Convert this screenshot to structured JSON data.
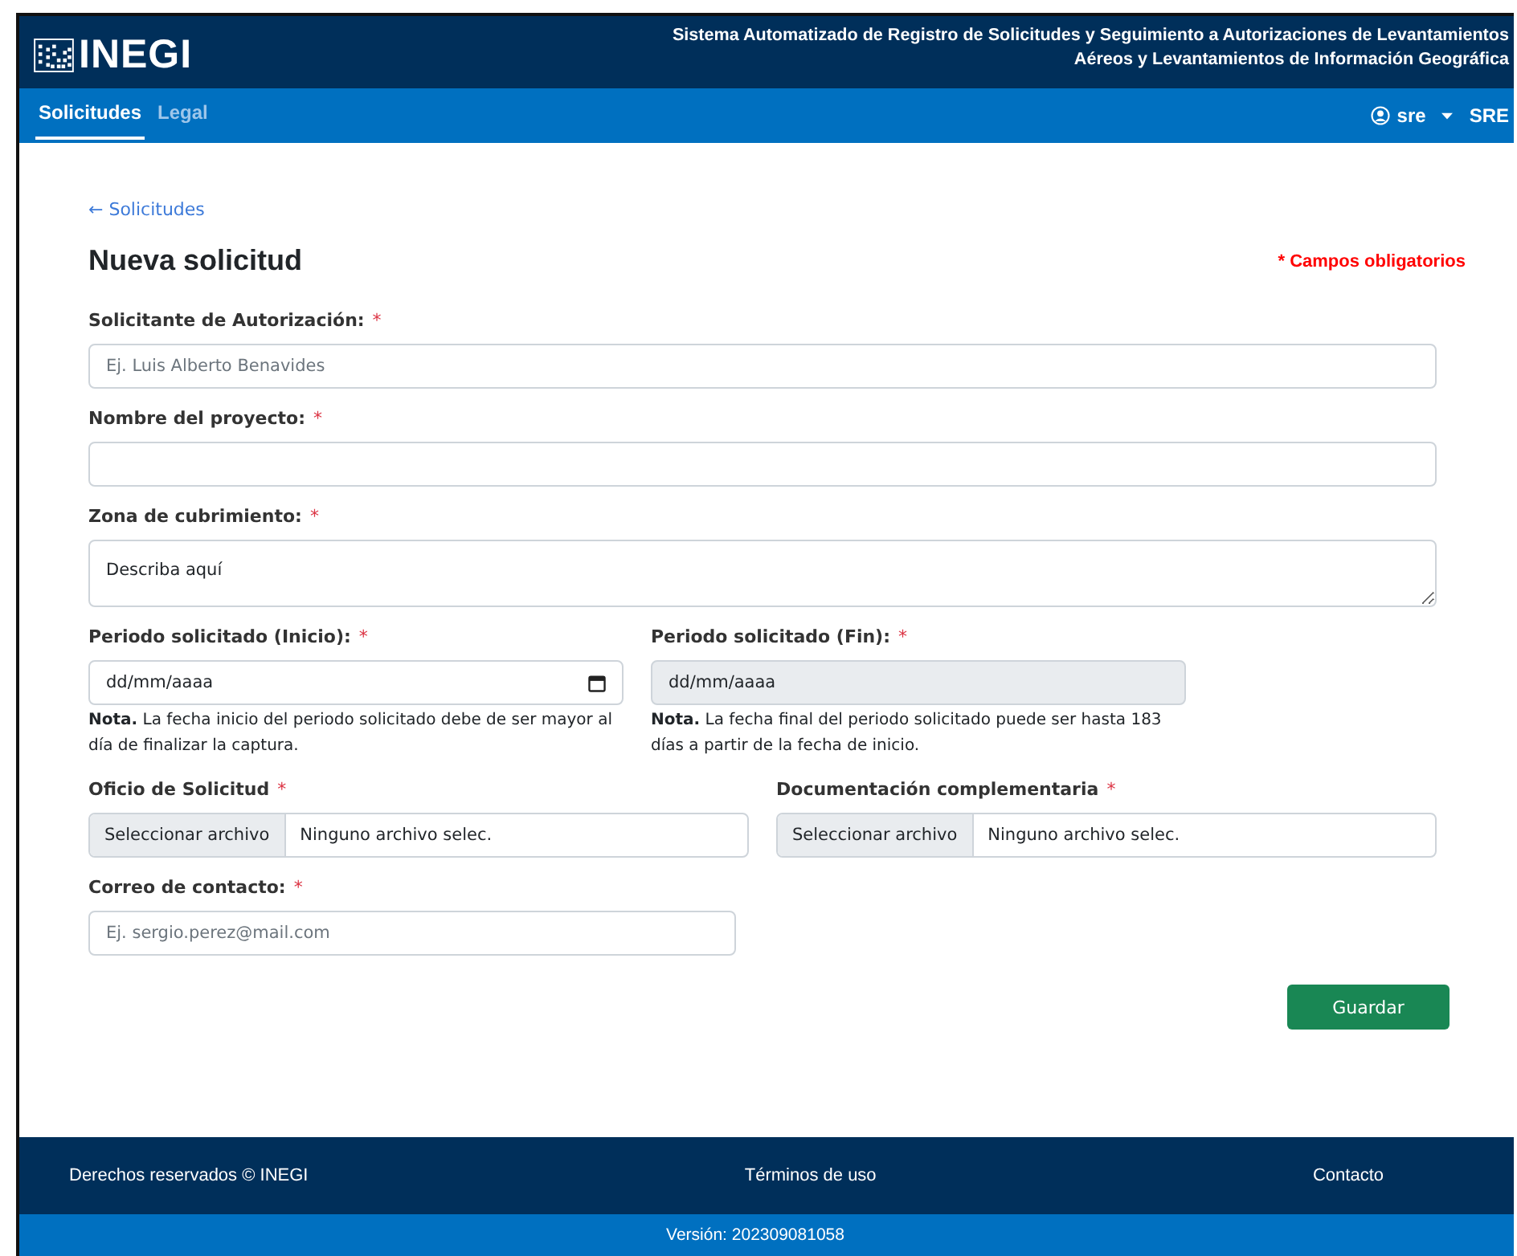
{
  "header": {
    "logo_text": "INEGI",
    "title_lines": [
      "Sistema Automatizado de Registro de Solicitudes y Seguimiento a Autorizaciones de Levantamientos",
      "Aéreos y Levantamientos de Información Geográfica"
    ]
  },
  "nav": {
    "tabs": [
      {
        "label": "Solicitudes",
        "selected": true
      },
      {
        "label": "Legal",
        "selected": false
      }
    ],
    "user": "sre",
    "user_extra": "SRE"
  },
  "form": {
    "back_link": "← Solicitudes",
    "title": "Nueva solicitud",
    "required_note": "* Campos obligatorios",
    "rows": [
      [
        {
          "kind": "text",
          "label": "Solicitante de Autorización:",
          "mark": "*",
          "placeholder": "Ej. Luis Alberto Benavides"
        }
      ],
      [
        {
          "kind": "text",
          "label": "Nombre del proyecto:",
          "mark": "*"
        }
      ],
      [
        {
          "kind": "textarea",
          "label": "Zona de cubrimiento:",
          "mark": "*",
          "placeholder": "Describa aquí"
        }
      ],
      [
        {
          "kind": "date",
          "label": "Periodo solicitado (Inicio):",
          "mark": "*",
          "placeholder": "dd/mm/aaaa",
          "disabled": false,
          "note": "**Nota.** La fecha inicio del periodo solicitado debe de ser mayor al día de finalizar la captura."
        },
        {
          "kind": "date",
          "label": "Periodo solicitado (Fin):",
          "mark": "*",
          "placeholder": "dd/mm/aaaa",
          "disabled": true,
          "note": "**Nota.** La fecha final del periodo solicitado puede ser hasta 183 días a partir de la fecha de inicio."
        }
      ],
      [
        {
          "kind": "file",
          "label": "Oficio de Solicitud",
          "mark": "*",
          "button": "Seleccionar archivo",
          "value": "Ninguno archivo selec."
        },
        {
          "kind": "file",
          "label": "Documentación complementaria",
          "mark": "*",
          "button": "Seleccionar archivo",
          "value": "Ninguno archivo selec."
        }
      ],
      [
        {
          "kind": "email",
          "label": "Correo de contacto:",
          "mark": "*",
          "placeholder": "Ej. sergio.perez@mail.com"
        }
      ]
    ],
    "submit": "Guardar"
  },
  "footer": {
    "links": [
      "Derechos reservados © INEGI",
      "Términos de uso",
      "Contacto"
    ],
    "version": "Versión: 202309081058"
  }
}
